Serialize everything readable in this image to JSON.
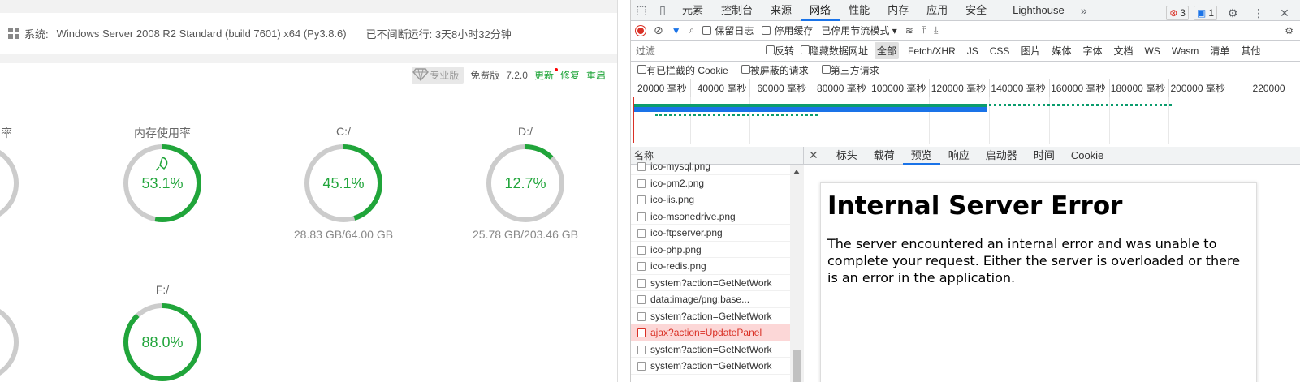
{
  "system": {
    "label": "系统:",
    "os": "Windows Server 2008 R2 Standard (build 7601) x64 (Py3.8.6)",
    "uptime": "已不间断运行: 3天8小时32分钟"
  },
  "version": {
    "pro": "专业版",
    "free": "免费版",
    "num": "7.2.0",
    "update": "更新",
    "repair": "修复",
    "restart": "重启"
  },
  "gauges": [
    {
      "title": "率",
      "pct": null
    },
    {
      "title": "内存使用率",
      "pct": "53.1%",
      "value": 53.1,
      "sub": ""
    },
    {
      "title": "C:/",
      "pct": "45.1%",
      "value": 45.1,
      "sub": "28.83 GB/64.00 GB"
    },
    {
      "title": "D:/",
      "pct": "12.7%",
      "value": 12.7,
      "sub": "25.78 GB/203.46 GB"
    },
    {
      "title": "F:/",
      "pct": "88.0%",
      "value": 88.0,
      "sub": ""
    }
  ],
  "colors": {
    "accent": "#20a53a",
    "track": "#cccccc",
    "error": "#d93025",
    "devtools_blue": "#1a73e8"
  },
  "devtools": {
    "tabs": [
      "元素",
      "控制台",
      "来源",
      "网络",
      "性能",
      "内存",
      "应用",
      "安全",
      "Lighthouse"
    ],
    "active_tab": "网络",
    "error_count": "3",
    "message_count": "1",
    "toolbar": {
      "preserve_log": "保留日志",
      "disable_cache": "停用缓存",
      "throttle": "已停用节流模式"
    },
    "filter": {
      "placeholder": "过滤",
      "invert": "反转",
      "hide_data_urls": "隐藏数据网址",
      "types": [
        "全部",
        "Fetch/XHR",
        "JS",
        "CSS",
        "图片",
        "媒体",
        "字体",
        "文档",
        "WS",
        "Wasm",
        "清单",
        "其他"
      ],
      "blocked_cookies": "有已拦截的 Cookie",
      "blocked_requests": "被屏蔽的请求",
      "third_party": "第三方请求"
    },
    "timeline_ticks": [
      "20000 毫秒",
      "40000 毫秒",
      "60000 毫秒",
      "80000 毫秒",
      "100000 毫秒",
      "120000 毫秒",
      "140000 毫秒",
      "160000 毫秒",
      "180000 毫秒",
      "200000 毫秒",
      "220000"
    ],
    "name_header": "名称",
    "requests": [
      {
        "name": "ico-mysql.png",
        "error": false
      },
      {
        "name": "ico-pm2.png",
        "error": false
      },
      {
        "name": "ico-iis.png",
        "error": false
      },
      {
        "name": "ico-msonedrive.png",
        "error": false
      },
      {
        "name": "ico-ftpserver.png",
        "error": false
      },
      {
        "name": "ico-php.png",
        "error": false
      },
      {
        "name": "ico-redis.png",
        "error": false
      },
      {
        "name": "system?action=GetNetWork",
        "error": false
      },
      {
        "name": "data:image/png;base...",
        "error": false
      },
      {
        "name": "system?action=GetNetWork",
        "error": false
      },
      {
        "name": "ajax?action=UpdatePanel",
        "error": true
      },
      {
        "name": "system?action=GetNetWork",
        "error": false
      },
      {
        "name": "system?action=GetNetWork",
        "error": false
      }
    ],
    "detail_tabs": [
      "标头",
      "载荷",
      "预览",
      "响应",
      "启动器",
      "时间",
      "Cookie"
    ],
    "active_detail_tab": "预览",
    "preview": {
      "title": "Internal Server Error",
      "body": "The server encountered an internal error and was unable to complete your request. Either the server is overloaded or there is an error in the application."
    }
  }
}
